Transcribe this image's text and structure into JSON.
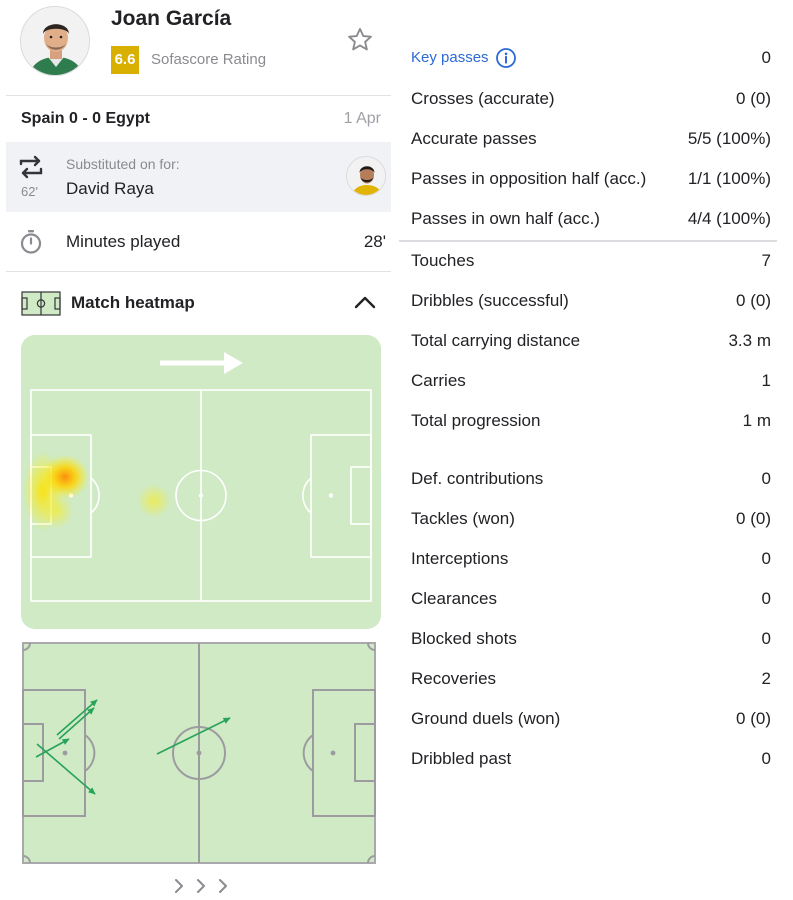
{
  "player": {
    "name": "Joan García",
    "rating": "6.6",
    "rating_label": "Sofascore Rating",
    "rating_color": "#d9af00",
    "favorite_icon": "star-outline-icon"
  },
  "match": {
    "teams": "Spain 0 - 0 Egypt",
    "date": "1 Apr"
  },
  "substitution": {
    "icon": "swap-icon",
    "minute": "62'",
    "label": "Substituted on for:",
    "player": "David Raya"
  },
  "minutes": {
    "icon": "stopwatch-icon",
    "label": "Minutes played",
    "value": "28'"
  },
  "heatmap": {
    "icon": "pitch-icon",
    "title": "Match heatmap",
    "toggle_icon": "chevron-up-icon",
    "direction_icon": "arrow-right-icon",
    "pitch_color": "#cfeac4",
    "line_color": "#ffffff"
  },
  "passmap": {
    "pass_color": "#27a35a",
    "more_icon": "chevron-right-icon"
  },
  "stats": {
    "group1": [
      {
        "label": "Key passes",
        "value": "0",
        "link": true
      },
      {
        "label": "Crosses (accurate)",
        "value": "0 (0)"
      },
      {
        "label": "Accurate passes",
        "value": "5/5 (100%)"
      },
      {
        "label": "Passes in opposition half (acc.)",
        "value": "1/1 (100%)"
      },
      {
        "label": "Passes in own half (acc.)",
        "value": "4/4 (100%)"
      }
    ],
    "group2": [
      {
        "label": "Touches",
        "value": "7"
      },
      {
        "label": "Dribbles (successful)",
        "value": "0 (0)"
      },
      {
        "label": "Total carrying distance",
        "value": "3.3 m"
      },
      {
        "label": "Carries",
        "value": "1"
      },
      {
        "label": "Total progression",
        "value": "1 m"
      }
    ],
    "group3": [
      {
        "label": "Def. contributions",
        "value": "0"
      },
      {
        "label": "Tackles (won)",
        "value": "0 (0)"
      },
      {
        "label": "Interceptions",
        "value": "0"
      },
      {
        "label": "Clearances",
        "value": "0"
      },
      {
        "label": "Blocked shots",
        "value": "0"
      },
      {
        "label": "Recoveries",
        "value": "2"
      },
      {
        "label": "Ground duels (won)",
        "value": "0 (0)"
      },
      {
        "label": "Dribbled past",
        "value": "0"
      }
    ]
  }
}
